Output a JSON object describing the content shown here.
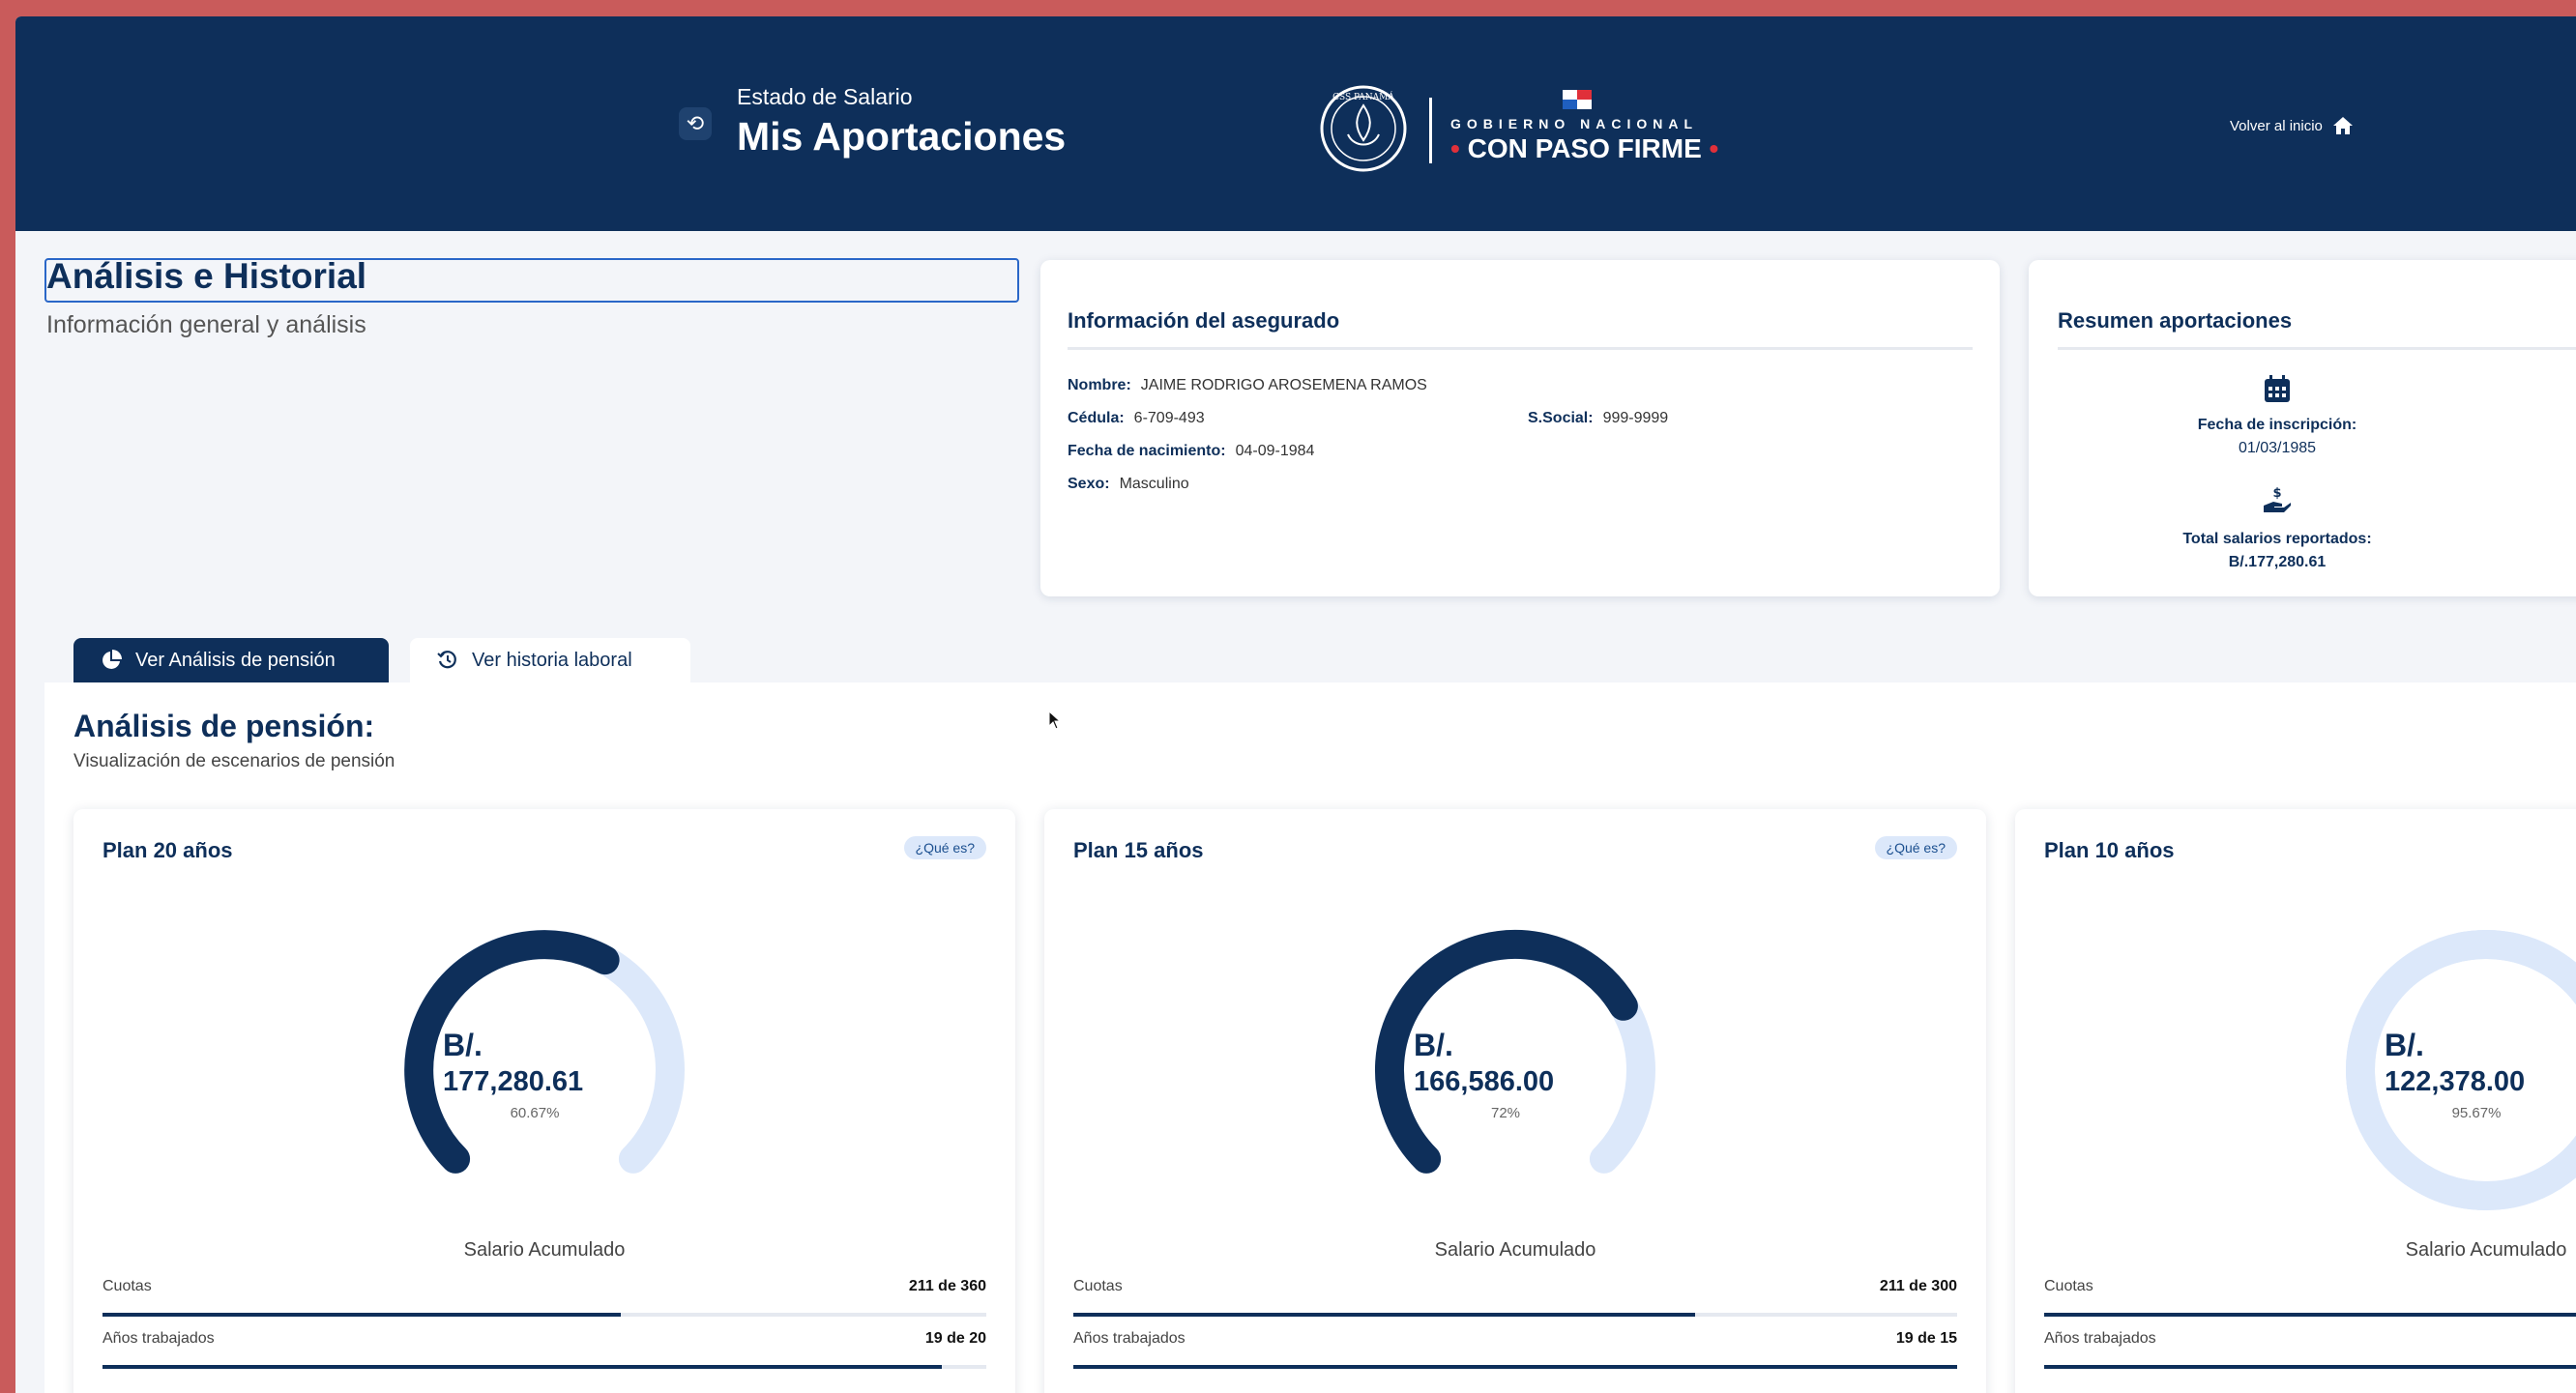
{
  "header": {
    "subtitle": "Estado de Salario",
    "title": "Mis Aportaciones",
    "gov_line1": "GOBIERNO NACIONAL",
    "gov_line2": "CON PASO FIRME",
    "back_home": "Volver al inicio",
    "seal_text": "CSS PANAMÁ"
  },
  "page": {
    "title": "Análisis e Historial",
    "subtitle": "Información general y análisis"
  },
  "insured_info": {
    "title": "Información del asegurado",
    "name_label": "Nombre:",
    "name": "JAIME RODRIGO AROSEMENA RAMOS",
    "id_label": "Cédula:",
    "id": "6-709-493",
    "ss_label": "S.Social:",
    "ss": "999-9999",
    "birth_label": "Fecha de nacimiento:",
    "birth": "04-09-1984",
    "sex_label": "Sexo:",
    "sex": "Masculino"
  },
  "summary": {
    "title": "Resumen aportaciones",
    "enroll_label": "Fecha de inscripción:",
    "enroll_date": "01/03/1985",
    "total_label": "Total salarios reportados:",
    "total_value": "B/.177,280.61"
  },
  "tabs": [
    {
      "label": "Ver Análisis de pensión",
      "icon": "pie-chart-icon",
      "active": true
    },
    {
      "label": "Ver historia laboral",
      "icon": "history-icon",
      "active": false
    }
  ],
  "section": {
    "title": "Análisis de pensión:",
    "subtitle": "Visualización de escenarios de pensión"
  },
  "plans": [
    {
      "title": "Plan 20 años",
      "info": "¿Qué es?",
      "currency": "B/.",
      "amount": "177,280.61",
      "percent": "60.67%",
      "percent_value": 0.6067,
      "gauge_label": "Salario Acumulado",
      "cuotas_label": "Cuotas",
      "cuotas": "211 de 360",
      "cuotas_ratio": 0.586,
      "years_label": "Años trabajados",
      "years": "19 de 20",
      "years_ratio": 0.95
    },
    {
      "title": "Plan 15 años",
      "info": "¿Qué es?",
      "currency": "B/.",
      "amount": "166,586.00",
      "percent": "72%",
      "percent_value": 0.72,
      "gauge_label": "Salario Acumulado",
      "cuotas_label": "Cuotas",
      "cuotas": "211 de 300",
      "cuotas_ratio": 0.703,
      "years_label": "Años trabajados",
      "years": "19 de 15",
      "years_ratio": 1.0
    },
    {
      "title": "Plan 10 años",
      "info": "¿Qué es?",
      "currency": "B/.",
      "amount": "122,378.00",
      "percent": "95.67%",
      "percent_value": 0.9567,
      "gauge_label": "Salario Acumulado",
      "cuotas_label": "Cuotas",
      "cuotas": "",
      "cuotas_ratio": 1.0,
      "years_label": "Años trabajados",
      "years": "",
      "years_ratio": 1.0
    }
  ],
  "colors": {
    "navy": "#0e2f5a",
    "track": "#dce8fa",
    "border": "#c95b5b",
    "flag_red": "#e0303a"
  }
}
